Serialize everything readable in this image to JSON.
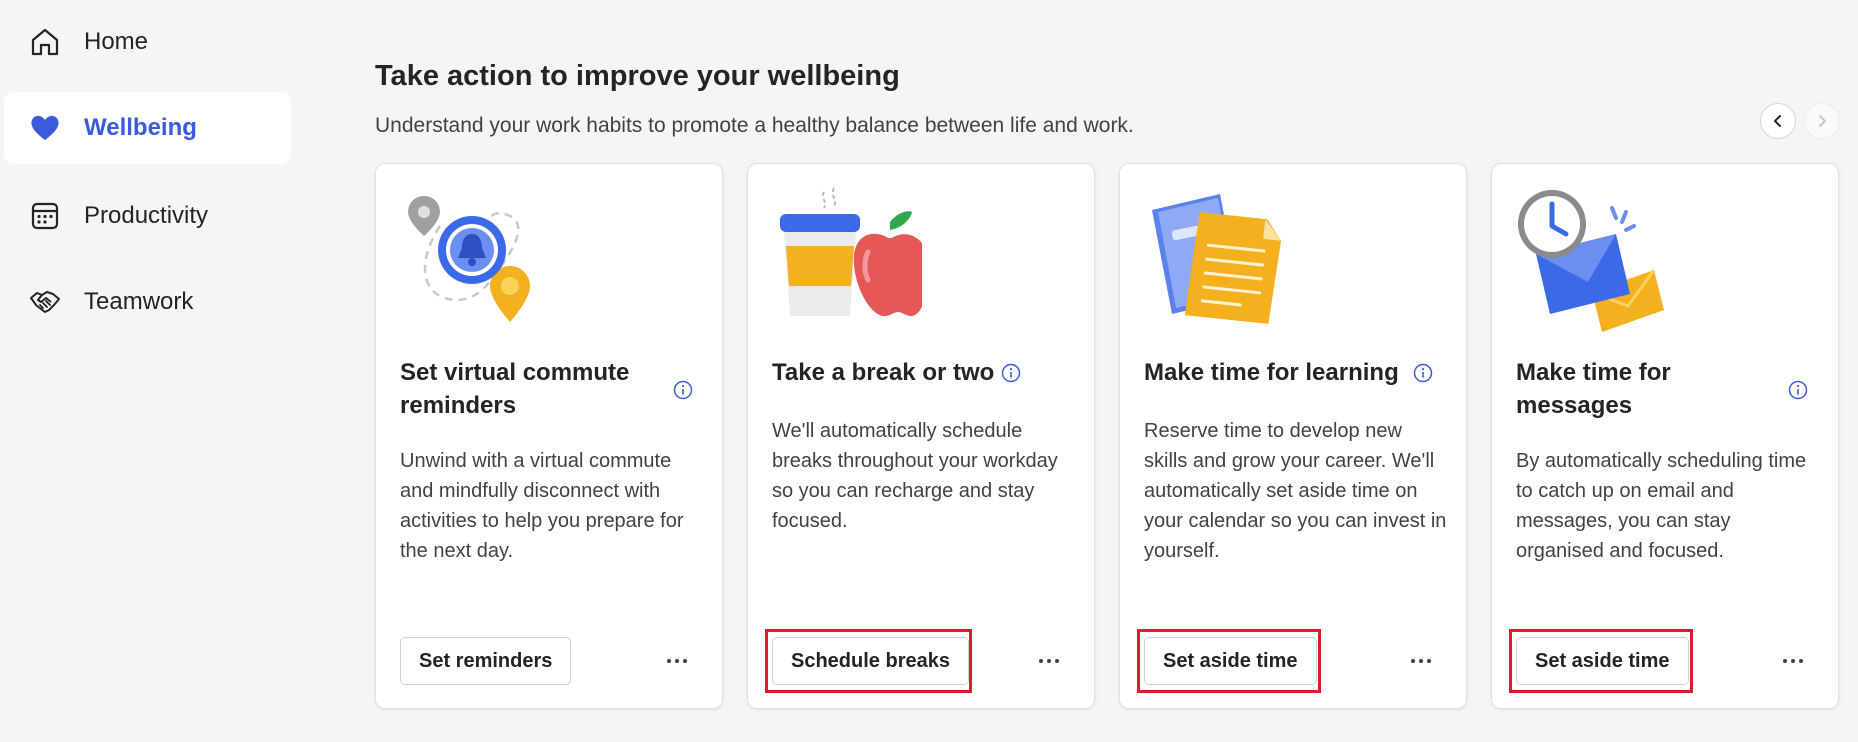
{
  "sidebar": {
    "items": [
      {
        "label": "Home",
        "icon": "home-icon"
      },
      {
        "label": "Wellbeing",
        "icon": "heart-icon",
        "active": true
      },
      {
        "label": "Productivity",
        "icon": "calendar-icon"
      },
      {
        "label": "Teamwork",
        "icon": "handshake-icon"
      }
    ]
  },
  "main": {
    "title": "Take action to improve your wellbeing",
    "subtitle": "Understand your work habits to promote a healthy balance between life and work.",
    "cards": [
      {
        "title": "Set virtual commute reminders",
        "description": "Unwind with a virtual commute and mindfully disconnect with activities to help you prepare for the next day.",
        "button": "Set reminders",
        "highlighted": false
      },
      {
        "title": "Take a break or two",
        "description": "We'll automatically schedule breaks throughout your workday so you can recharge and stay focused.",
        "button": "Schedule breaks",
        "highlighted": true
      },
      {
        "title": "Make time for learning",
        "description": "Reserve time to develop new skills and grow your career. We'll automatically set aside time on your calendar so you can invest in yourself.",
        "button": "Set aside time",
        "highlighted": true
      },
      {
        "title": "Make time for messages",
        "description": "By automatically scheduling time to catch up on email and messages, you can stay organised and focused.",
        "button": "Set aside time",
        "highlighted": true
      }
    ]
  },
  "colors": {
    "accent": "#3b5bdb",
    "highlight": "#d9202a",
    "background": "#f5f5f5"
  }
}
